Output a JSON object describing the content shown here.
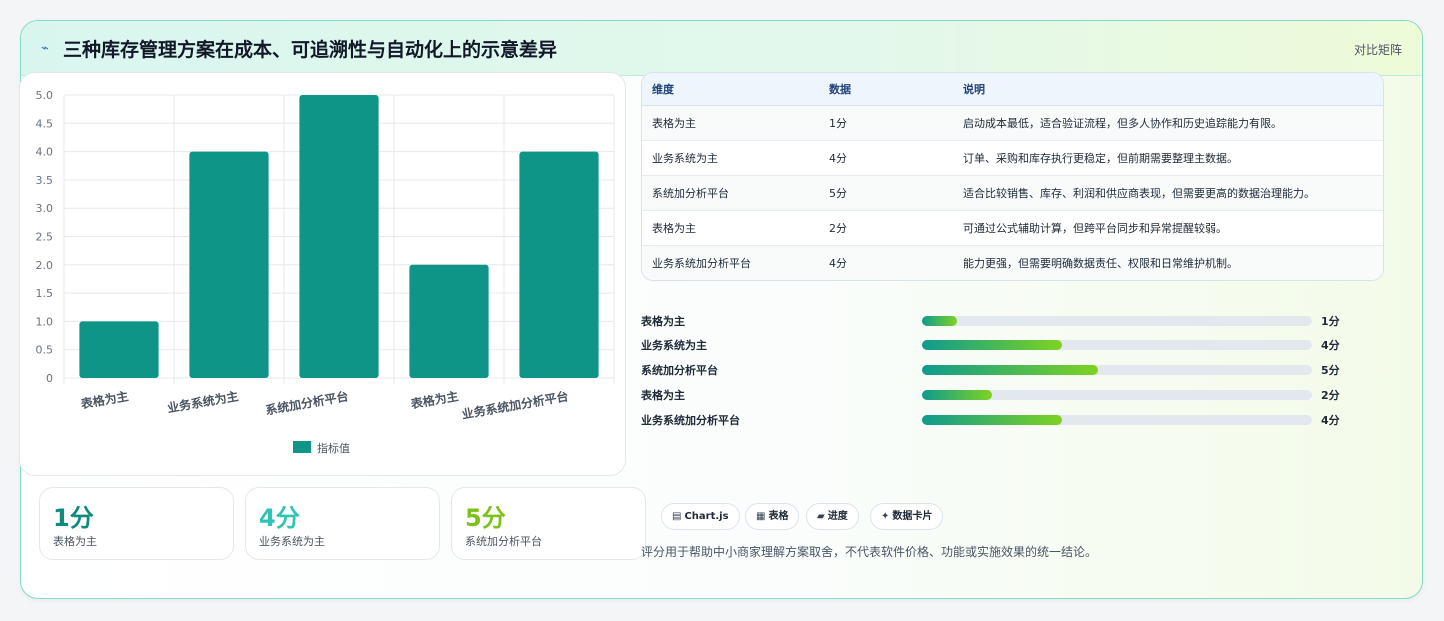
{
  "header": {
    "title": "三种库存管理方案在成本、可追溯性与自动化上的示意差异",
    "mode_label": "对比矩阵"
  },
  "chart_data": {
    "type": "bar",
    "categories": [
      "表格为主",
      "业务系统为主",
      "系统加分析平台",
      "表格为主",
      "业务系统加分析平台"
    ],
    "series": [
      {
        "name": "指标值",
        "values": [
          1,
          4,
          5,
          2,
          4
        ]
      }
    ],
    "ylim": [
      0,
      5
    ],
    "yticks": [
      "5.0",
      "4.5",
      "4.0",
      "3.5",
      "3.0",
      "2.5",
      "2.0",
      "1.5",
      "1.0",
      "0.5",
      "0"
    ],
    "grid": true,
    "legend": "bottom",
    "bar_color": "#0f9488"
  },
  "kpis": [
    {
      "value": "1分",
      "label": "表格为主",
      "color": "#0f8a7f"
    },
    {
      "value": "4分",
      "label": "业务系统为主",
      "color": "#2ec4b6"
    },
    {
      "value": "5分",
      "label": "系统加分析平台",
      "color": "#7cc21a"
    }
  ],
  "table": {
    "headers": [
      "维度",
      "数据",
      "说明"
    ],
    "rows": [
      {
        "dim": "表格为主",
        "value": "1分",
        "desc": "启动成本最低，适合验证流程，但多人协作和历史追踪能力有限。"
      },
      {
        "dim": "业务系统为主",
        "value": "4分",
        "desc": "订单、采购和库存执行更稳定，但前期需要整理主数据。"
      },
      {
        "dim": "系统加分析平台",
        "value": "5分",
        "desc": "适合比较销售、库存、利润和供应商表现，但需要更高的数据治理能力。"
      },
      {
        "dim": "表格为主",
        "value": "2分",
        "desc": "可通过公式辅助计算，但跨平台同步和异常提醒较弱。"
      },
      {
        "dim": "业务系统加分析平台",
        "value": "4分",
        "desc": "能力更强，但需要明确数据责任、权限和日常维护机制。"
      }
    ]
  },
  "progress": [
    {
      "label": "表格为主",
      "value_text": "1分",
      "fraction": 0.09
    },
    {
      "label": "业务系统为主",
      "value_text": "4分",
      "fraction": 0.36
    },
    {
      "label": "系统加分析平台",
      "value_text": "5分",
      "fraction": 0.45
    },
    {
      "label": "表格为主",
      "value_text": "2分",
      "fraction": 0.18
    },
    {
      "label": "业务系统加分析平台",
      "value_text": "4分",
      "fraction": 0.36
    }
  ],
  "chips": [
    {
      "icon": "▤",
      "icon_name": "chart-icon",
      "label": "Chart.js"
    },
    {
      "icon": "▦",
      "icon_name": "table-icon",
      "label": "表格"
    },
    {
      "icon": "▰",
      "icon_name": "progress-icon",
      "label": "进度"
    },
    {
      "icon": "✦",
      "icon_name": "sparkle-icon",
      "label": "数据卡片"
    }
  ],
  "note": "评分用于帮助中小商家理解方案取舍，不代表软件价格、功能或实施效果的统一结论。"
}
